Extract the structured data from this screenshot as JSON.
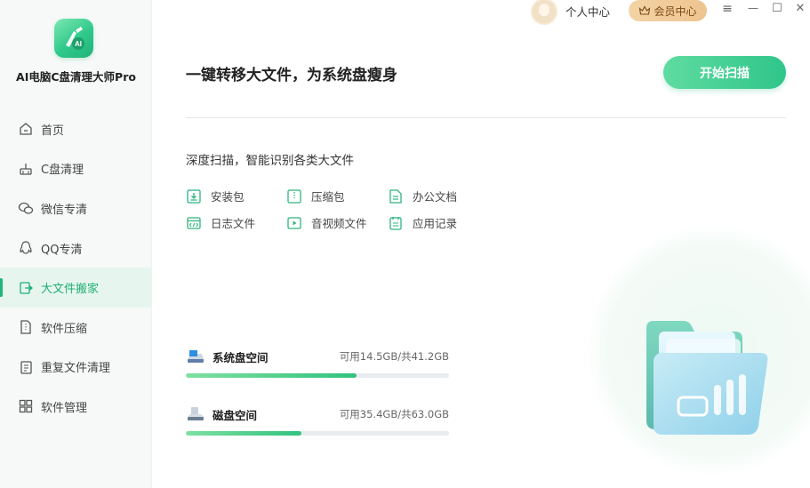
{
  "app": {
    "name": "AI电脑C盘清理大师Pro",
    "logo_text": "AI"
  },
  "topbar": {
    "user_center": "个人中心",
    "vip_label": "会员中心",
    "menu_icon": "≡",
    "minimize_icon": "—",
    "maximize_icon": "☐",
    "close_icon": "✕"
  },
  "sidebar": {
    "items": [
      {
        "label": "首页",
        "icon": "home-icon"
      },
      {
        "label": "C盘清理",
        "icon": "broom-icon"
      },
      {
        "label": "微信专清",
        "icon": "wechat-icon"
      },
      {
        "label": "QQ专清",
        "icon": "qq-icon"
      },
      {
        "label": "大文件搬家",
        "icon": "move-file-icon",
        "active": true
      },
      {
        "label": "软件压缩",
        "icon": "compress-icon"
      },
      {
        "label": "重复文件清理",
        "icon": "duplicate-file-icon"
      },
      {
        "label": "软件管理",
        "icon": "app-grid-icon"
      }
    ]
  },
  "main": {
    "headline": "一键转移大文件，为系统盘瘦身",
    "scan_button": "开始扫描",
    "subtitle": "深度扫描，智能识别各类大文件",
    "file_types": [
      {
        "label": "安装包",
        "icon": "install-package-icon"
      },
      {
        "label": "压缩包",
        "icon": "zip-icon"
      },
      {
        "label": "办公文档",
        "icon": "document-icon"
      },
      {
        "label": "日志文件",
        "icon": "log-file-icon"
      },
      {
        "label": "音视频文件",
        "icon": "media-file-icon"
      },
      {
        "label": "应用记录",
        "icon": "app-record-icon"
      }
    ],
    "disks": [
      {
        "name": "系统盘空间",
        "free_text": "可用14.5GB/共41.2GB",
        "used_fraction": 0.648,
        "icon": "system-disk-icon"
      },
      {
        "name": "磁盘空间",
        "free_text": "可用35.4GB/共63.0GB",
        "used_fraction": 0.438,
        "icon": "disk-icon"
      }
    ]
  },
  "colors": {
    "accent": "#2fc58a",
    "active_bg": "#e6f6ee",
    "vip": "#eec48f"
  }
}
